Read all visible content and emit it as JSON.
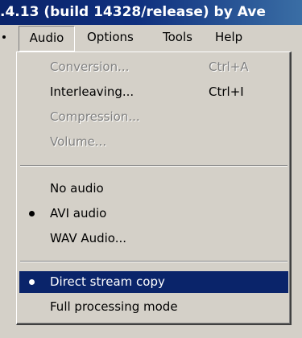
{
  "window": {
    "title": ".4.13 (build 14328/release) by Ave"
  },
  "menubar": {
    "audio": "Audio",
    "options": "Options",
    "tools": "Tools",
    "help": "Help"
  },
  "menu": {
    "conversion": {
      "label": "Conversion...",
      "shortcut": "Ctrl+A"
    },
    "interleaving": {
      "label": "Interleaving...",
      "shortcut": "Ctrl+I"
    },
    "compression": {
      "label": "Compression..."
    },
    "volume": {
      "label": "Volume..."
    },
    "no_audio": {
      "label": "No audio"
    },
    "avi_audio": {
      "label": "AVI audio"
    },
    "wav_audio": {
      "label": "WAV Audio..."
    },
    "direct_stream_copy": {
      "label": "Direct stream copy"
    },
    "full_processing": {
      "label": "Full processing mode"
    }
  },
  "colors": {
    "highlight": "#0a246a",
    "menu_bg": "#d4d0c8",
    "disabled_text": "#808080"
  }
}
